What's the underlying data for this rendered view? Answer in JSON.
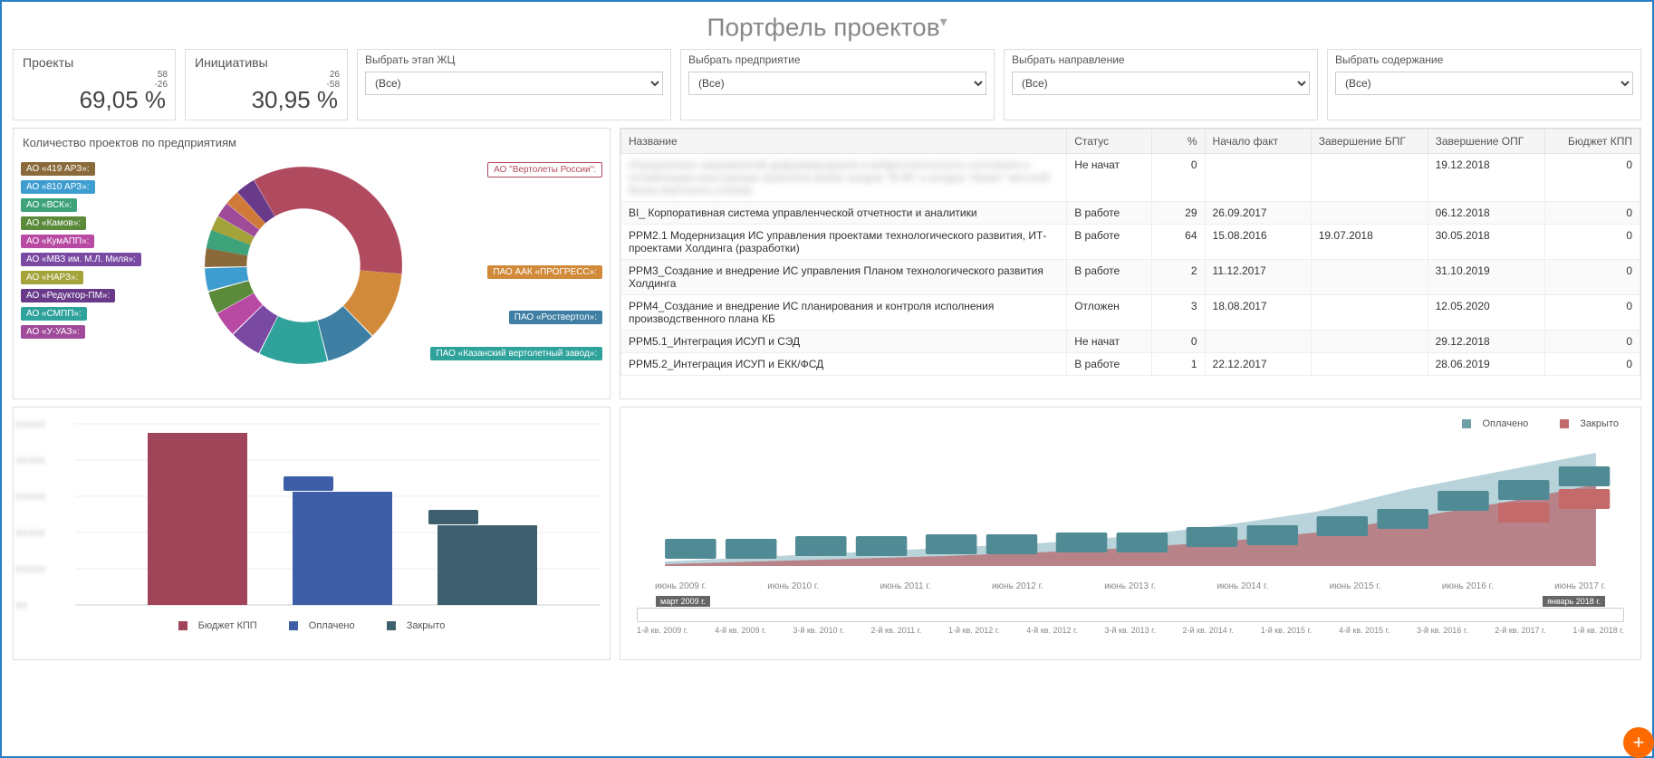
{
  "title": "Портфель проектов",
  "kpi": {
    "projects": {
      "label": "Проекты",
      "count": "58",
      "delta": "-26",
      "value": "69,05 %"
    },
    "initiatives": {
      "label": "Инициативы",
      "count": "26",
      "delta": "-58",
      "value": "30,95 %"
    }
  },
  "filters": {
    "stage": {
      "label": "Выбрать этап ЖЦ",
      "value": "(Все)"
    },
    "enterprise": {
      "label": "Выбрать предприятие",
      "value": "(Все)"
    },
    "direction": {
      "label": "Выбрать направление",
      "value": "(Все)"
    },
    "content": {
      "label": "Выбрать содержание",
      "value": "(Все)"
    }
  },
  "donut": {
    "title": "Количество проектов по предприятиям",
    "companies": [
      "АО «419 АРЗ»:",
      "АО «810 АРЗ»:",
      "АО «ВСК»:",
      "АО «Камов»:",
      "АО «КумАПП»:",
      "АО «МВЗ им. М.Л. Миля»:",
      "АО «НАРЗ»:",
      "АО «Редуктор-ПМ»:",
      "АО «СМПП»:",
      "АО «У-УАЗ»:",
      "АО \"Вертолеты России\":",
      "ПАО ААК «ПРОГРЕСС»:",
      "ПАО «Роствертол»:",
      "ПАО «Казанский вертолетный завод»:"
    ]
  },
  "table": {
    "headers": {
      "name": "Название",
      "status": "Статус",
      "pct": "%",
      "start": "Начало факт",
      "endBPG": "Завершение БПГ",
      "endOPG": "Завершение ОПГ",
      "budget": "Бюджет КПП"
    },
    "rows": [
      {
        "name": "Определение направлений деформирования и вибростатического состояния и оптимизация конструкции агрегатов жабки анодов \"В-48\" и анодов \"Авиат\" жесткой балки вертолета (темза)",
        "blurred": true,
        "status": "Не начат",
        "pct": "0",
        "start": "",
        "endBPG": "",
        "endOPG": "19.12.2018",
        "budget": "0"
      },
      {
        "name": "BI_ Корпоративная система управленческой отчетности и аналитики",
        "status": "В работе",
        "pct": "29",
        "start": "26.09.2017",
        "endBPG": "",
        "endOPG": "06.12.2018",
        "budget": "0"
      },
      {
        "name": "PPM2.1 Модернизация ИС управления проектами технологического развития, ИТ-проектами Холдинга (разработки)",
        "status": "В работе",
        "pct": "64",
        "start": "15.08.2016",
        "endBPG": "19.07.2018",
        "endOPG": "30.05.2018",
        "budget": "0"
      },
      {
        "name": "PPM3_Создание и внедрение ИС управления Планом технологического развития Холдинга",
        "status": "В работе",
        "pct": "2",
        "start": "11.12.2017",
        "endBPG": "",
        "endOPG": "31.10.2019",
        "budget": "0"
      },
      {
        "name": "PPM4_Создание и внедрение ИС планирования и контроля исполнения производственного плана КБ",
        "status": "Отложен",
        "pct": "3",
        "start": "18.08.2017",
        "endBPG": "",
        "endOPG": "12.05.2020",
        "budget": "0"
      },
      {
        "name": "PPM5.1_Интеграция ИСУП и СЭД",
        "status": "Не начат",
        "pct": "0",
        "start": "",
        "endBPG": "",
        "endOPG": "29.12.2018",
        "budget": "0"
      },
      {
        "name": "PPM5.2_Интеграция ИСУП и ЕКК/ФСД",
        "status": "В работе",
        "pct": "1",
        "start": "22.12.2017",
        "endBPG": "",
        "endOPG": "28.06.2019",
        "budget": "0"
      }
    ]
  },
  "bar_chart": {
    "legend": {
      "budget": "Бюджет КПП",
      "paid": "Оплачено",
      "closed": "Закрыто"
    }
  },
  "area_chart": {
    "legend": {
      "paid": "Оплачено",
      "closed": "Закрыто"
    },
    "x_labels": [
      "июнь 2009 г.",
      "июнь 2010 г.",
      "июнь 2011 г.",
      "июнь 2012 г.",
      "июнь 2013 г.",
      "июнь 2014 г.",
      "июнь 2015 г.",
      "июнь 2016 г.",
      "июнь 2017 г."
    ],
    "slider": {
      "start": "март 2009 г.",
      "end": "январь 2018 г."
    },
    "slider_ticks": [
      "1-й кв. 2009 г.",
      "4-й кв. 2009 г.",
      "3-й кв. 2010 г.",
      "2-й кв. 2011 г.",
      "1-й кв. 2012 г.",
      "4-й кв. 2012 г.",
      "3-й кв. 2013 г.",
      "2-й кв. 2014 г.",
      "1-й кв. 2015 г.",
      "4-й кв. 2015 г.",
      "3-й кв. 2016 г.",
      "2-й кв. 2017 г.",
      "1-й кв. 2018 г."
    ]
  },
  "chart_data": [
    {
      "type": "pie",
      "title": "Количество проектов по предприятиям",
      "note": "donut; largest slice = АО \"Вертолеты России\" ~35–40%; remaining slices small and roughly equal (~3–7% each); exact values redacted/blurred in source",
      "categories": [
        "АО «419 АРЗ»",
        "АО «810 АРЗ»",
        "АО «ВСК»",
        "АО «Камов»",
        "АО «КумАПП»",
        "АО «МВЗ им. М.Л. Миля»",
        "АО «НАРЗ»",
        "АО «Редуктор-ПМ»",
        "АО «СМПП»",
        "АО «У-УАЗ»",
        "АО \"Вертолеты России\"",
        "ПАО ААК «ПРОГРЕСС»",
        "ПАО «Роствертол»",
        "ПАО «Казанский вертолетный завод»"
      ],
      "values": [
        3,
        3,
        3,
        4,
        4,
        5,
        3,
        4,
        3,
        4,
        38,
        6,
        7,
        13
      ]
    },
    {
      "type": "bar",
      "title": "",
      "note": "y-axis labels blurred in source; relative bar heights estimated",
      "categories": [
        "Бюджет КПП",
        "Оплачено",
        "Закрыто"
      ],
      "values": [
        100,
        63,
        44
      ],
      "colors": [
        "#a0445a",
        "#3e5fa8",
        "#3e5f6d"
      ]
    },
    {
      "type": "area",
      "title": "",
      "note": "cumulative stacked area with bar overlays; y-axis labels blurred; values estimated relative to max=100",
      "x": [
        "июнь 2009 г.",
        "июнь 2010 г.",
        "июнь 2011 г.",
        "июнь 2012 г.",
        "июнь 2013 г.",
        "июнь 2014 г.",
        "июнь 2015 г.",
        "июнь 2016 г.",
        "июнь 2017 г."
      ],
      "series": [
        {
          "name": "Оплачено",
          "values": [
            5,
            10,
            15,
            20,
            25,
            33,
            45,
            65,
            95
          ],
          "color": "#6fa0aa"
        },
        {
          "name": "Закрыто",
          "values": [
            3,
            6,
            9,
            12,
            15,
            20,
            28,
            40,
            60
          ],
          "color": "#a0445a"
        }
      ]
    }
  ]
}
